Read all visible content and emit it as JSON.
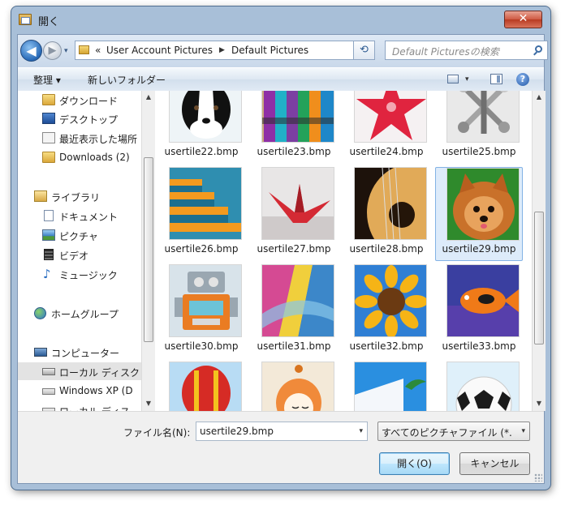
{
  "window": {
    "title": "開く"
  },
  "titlebar": {
    "close_glyph": "✕"
  },
  "nav": {
    "back_glyph": "◀",
    "forward_glyph": "▶",
    "breadcrumb": {
      "overflow": "«",
      "items": [
        "User Account Pictures",
        "Default Pictures"
      ],
      "separator": "▶"
    },
    "refresh_glyph": "⟲",
    "search_placeholder": "Default Picturesの検索"
  },
  "toolbar": {
    "organize": "整理 ▾",
    "new_folder": "新しいフォルダー",
    "help": "?"
  },
  "sidebar": {
    "items": [
      {
        "label": "ダウンロード",
        "icon": "folder-icon"
      },
      {
        "label": "デスクトップ",
        "icon": "desktop-icon"
      },
      {
        "label": "最近表示した場所",
        "icon": "recent-places-icon"
      },
      {
        "label": "Downloads (2)",
        "icon": "folder-icon"
      },
      {
        "label": "ライブラリ",
        "icon": "library-icon"
      },
      {
        "label": "ドキュメント",
        "icon": "documents-icon"
      },
      {
        "label": "ピクチャ",
        "icon": "pictures-icon"
      },
      {
        "label": "ビデオ",
        "icon": "videos-icon"
      },
      {
        "label": "ミュージック",
        "icon": "music-icon"
      },
      {
        "label": "ホームグループ",
        "icon": "homegroup-icon"
      },
      {
        "label": "コンピューター",
        "icon": "computer-icon"
      },
      {
        "label": "ローカル ディスク",
        "icon": "local-disk-icon"
      },
      {
        "label": "Windows XP (D",
        "icon": "drive-icon"
      },
      {
        "label": "ローカル ディス",
        "icon": "drive-icon"
      }
    ],
    "music_glyph": "♪"
  },
  "files": [
    {
      "name": "usertile22.bmp",
      "subject": "border-collie"
    },
    {
      "name": "usertile23.bmp",
      "subject": "crayons"
    },
    {
      "name": "usertile24.bmp",
      "subject": "red-star"
    },
    {
      "name": "usertile25.bmp",
      "subject": "metal-jacks"
    },
    {
      "name": "usertile26.bmp",
      "subject": "orange-steps"
    },
    {
      "name": "usertile27.bmp",
      "subject": "paper-crane"
    },
    {
      "name": "usertile28.bmp",
      "subject": "guitar"
    },
    {
      "name": "usertile29.bmp",
      "subject": "pomeranian",
      "selected": true
    },
    {
      "name": "usertile30.bmp",
      "subject": "toy-robot"
    },
    {
      "name": "usertile31.bmp",
      "subject": "silk-scarves"
    },
    {
      "name": "usertile32.bmp",
      "subject": "sunflower"
    },
    {
      "name": "usertile33.bmp",
      "subject": "tropical-fish"
    },
    {
      "name": "",
      "subject": "hot-air-balloon"
    },
    {
      "name": "",
      "subject": "kokeshi-doll"
    },
    {
      "name": "",
      "subject": "beach-building"
    },
    {
      "name": "",
      "subject": "soccer-ball"
    }
  ],
  "footer": {
    "filename_label": "ファイル名(N):",
    "filename_value": "usertile29.bmp",
    "filter_value": "すべてのピクチャファイル (*.",
    "dropdown_glyph": "▾",
    "open_button": "開く(O)",
    "cancel_button": "キャンセル"
  },
  "scrollbar": {
    "up_glyph": "▲",
    "down_glyph": "▼"
  },
  "colors": {
    "selection": "#ddebfa",
    "accent": "#2769b7"
  }
}
